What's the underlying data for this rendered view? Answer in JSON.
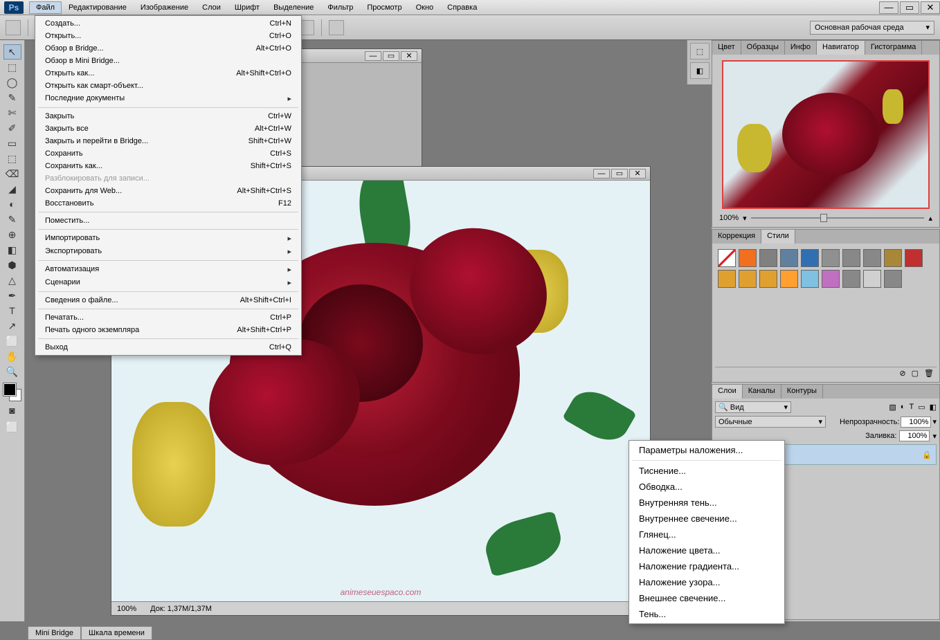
{
  "app": {
    "logo": "Ps"
  },
  "menubar": {
    "items": [
      "Файл",
      "Редактирование",
      "Изображение",
      "Слои",
      "Шрифт",
      "Выделение",
      "Фильтр",
      "Просмотр",
      "Окно",
      "Справка"
    ],
    "active_index": 0
  },
  "window_controls": {
    "min": "—",
    "max": "▭",
    "close": "✕"
  },
  "optbar": {
    "workspace": "Основная рабочая среда"
  },
  "file_menu": [
    {
      "label": "Создать...",
      "shortcut": "Ctrl+N"
    },
    {
      "label": "Открыть...",
      "shortcut": "Ctrl+O"
    },
    {
      "label": "Обзор в Bridge...",
      "shortcut": "Alt+Ctrl+O"
    },
    {
      "label": "Обзор в Mini Bridge...",
      "shortcut": ""
    },
    {
      "label": "Открыть как...",
      "shortcut": "Alt+Shift+Ctrl+O"
    },
    {
      "label": "Открыть как смарт-объект...",
      "shortcut": ""
    },
    {
      "label": "Последние документы",
      "shortcut": "",
      "sub": true
    },
    {
      "sep": true
    },
    {
      "label": "Закрыть",
      "shortcut": "Ctrl+W"
    },
    {
      "label": "Закрыть все",
      "shortcut": "Alt+Ctrl+W"
    },
    {
      "label": "Закрыть и перейти в Bridge...",
      "shortcut": "Shift+Ctrl+W"
    },
    {
      "label": "Сохранить",
      "shortcut": "Ctrl+S"
    },
    {
      "label": "Сохранить как...",
      "shortcut": "Shift+Ctrl+S"
    },
    {
      "label": "Разблокировать для записи...",
      "shortcut": "",
      "disabled": true
    },
    {
      "label": "Сохранить для Web...",
      "shortcut": "Alt+Shift+Ctrl+S"
    },
    {
      "label": "Восстановить",
      "shortcut": "F12"
    },
    {
      "sep": true
    },
    {
      "label": "Поместить...",
      "shortcut": ""
    },
    {
      "sep": true
    },
    {
      "label": "Импортировать",
      "shortcut": "",
      "sub": true
    },
    {
      "label": "Экспортировать",
      "shortcut": "",
      "sub": true
    },
    {
      "sep": true
    },
    {
      "label": "Автоматизация",
      "shortcut": "",
      "sub": true
    },
    {
      "label": "Сценарии",
      "shortcut": "",
      "sub": true
    },
    {
      "sep": true
    },
    {
      "label": "Сведения о файле...",
      "shortcut": "Alt+Shift+Ctrl+I"
    },
    {
      "sep": true
    },
    {
      "label": "Печатать...",
      "shortcut": "Ctrl+P"
    },
    {
      "label": "Печать одного экземпляра",
      "shortcut": "Alt+Shift+Ctrl+P"
    },
    {
      "sep": true
    },
    {
      "label": "Выход",
      "shortcut": "Ctrl+Q"
    }
  ],
  "tools": [
    "↖",
    "⬚",
    "◯",
    "✎",
    "✄",
    "✐",
    "▭",
    "⬚",
    "⌫",
    "◢",
    "◐",
    "✎",
    "⊕",
    "◧",
    "⬢",
    "△",
    "✒",
    "T",
    "↗",
    "⬜",
    "✋",
    "🔍"
  ],
  "doc": {
    "zoom": "100%",
    "size": "Док: 1,37M/1,37M",
    "watermark": "animeseuespaco.com"
  },
  "context_menu": [
    {
      "label": "Параметры наложения..."
    },
    {
      "sep": true
    },
    {
      "label": "Тиснение..."
    },
    {
      "label": "Обводка..."
    },
    {
      "label": "Внутренняя тень..."
    },
    {
      "label": "Внутреннее свечение..."
    },
    {
      "label": "Глянец..."
    },
    {
      "label": "Наложение цвета..."
    },
    {
      "label": "Наложение градиента..."
    },
    {
      "label": "Наложение узора..."
    },
    {
      "label": "Внешнее свечение..."
    },
    {
      "label": "Тень..."
    }
  ],
  "panels": {
    "top_tabs": [
      "Цвет",
      "Образцы",
      "Инфо",
      "Навигатор",
      "Гистограмма"
    ],
    "top_active": 3,
    "nav_zoom": "100%",
    "mid_tabs": [
      "Коррекция",
      "Стили"
    ],
    "mid_active": 1,
    "style_colors": [
      "#fff",
      "#f07020",
      "#808080",
      "#6080a0",
      "#3070b0",
      "#909090",
      "#888",
      "#888",
      "#a88838",
      "#c03030",
      "#e0a030",
      "#e0a030",
      "#e0a030",
      "#ffa030",
      "#80c0e0",
      "#c070c0",
      "#888",
      "#d0d0d0",
      "#888"
    ],
    "bot_tabs": [
      "Слои",
      "Каналы",
      "Контуры"
    ],
    "bot_active": 0,
    "layer_filter": "Вид",
    "blend_mode": "Обычные",
    "opacity_label": "Непрозрачность:",
    "opacity_value": "100%",
    "fill_label": "Заливка:",
    "fill_value": "100%",
    "lock_icon": "🔒"
  },
  "bottom_tabs": [
    "Mini Bridge",
    "Шкала времени"
  ]
}
